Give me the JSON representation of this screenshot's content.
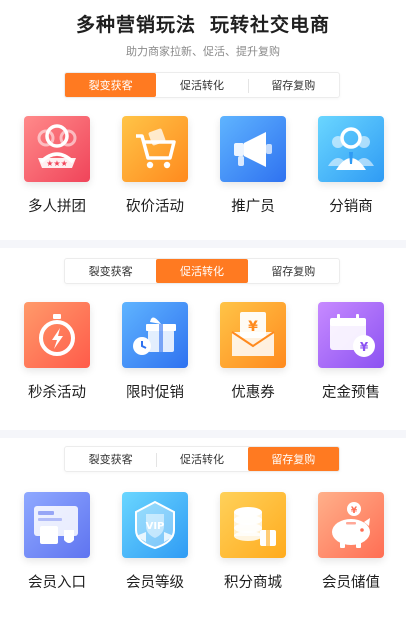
{
  "header": {
    "title_part1": "多种营销玩法",
    "title_part2": "玩转社交电商",
    "subtitle": "助力商家拉新、促活、提升复购"
  },
  "sections": [
    {
      "tabs": [
        "裂变获客",
        "促活转化",
        "留存复购"
      ],
      "active_tab": 0,
      "items": [
        {
          "label": "多人拼团",
          "icon": "group-buy-icon"
        },
        {
          "label": "砍价活动",
          "icon": "bargain-cart-icon"
        },
        {
          "label": "推广员",
          "icon": "megaphone-icon"
        },
        {
          "label": "分销商",
          "icon": "distributor-icon"
        }
      ]
    },
    {
      "tabs": [
        "裂变获客",
        "促活转化",
        "留存复购"
      ],
      "active_tab": 1,
      "items": [
        {
          "label": "秒杀活动",
          "icon": "flash-timer-icon"
        },
        {
          "label": "限时促销",
          "icon": "gift-clock-icon"
        },
        {
          "label": "优惠券",
          "icon": "coupon-wallet-icon"
        },
        {
          "label": "定金预售",
          "icon": "calendar-coin-icon"
        }
      ]
    },
    {
      "tabs": [
        "裂变获客",
        "促活转化",
        "留存复购"
      ],
      "active_tab": 2,
      "items": [
        {
          "label": "会员入口",
          "icon": "member-card-icon"
        },
        {
          "label": "会员等级",
          "icon": "vip-badge-icon"
        },
        {
          "label": "积分商城",
          "icon": "points-coins-icon"
        },
        {
          "label": "会员储值",
          "icon": "piggy-bank-icon"
        }
      ]
    }
  ],
  "colors": {
    "accent": "#ff7a21"
  }
}
